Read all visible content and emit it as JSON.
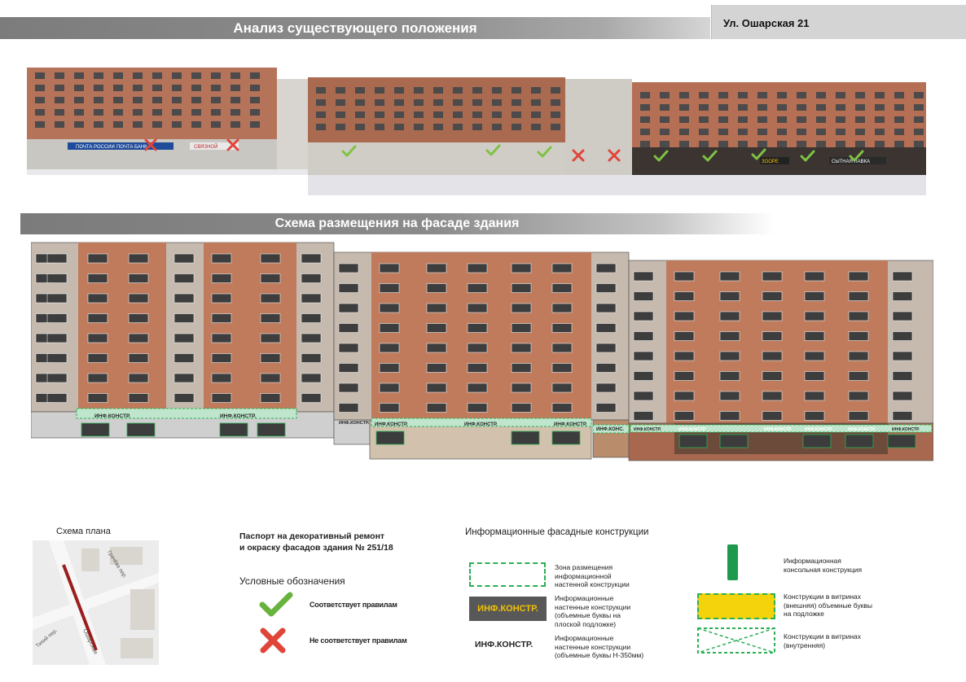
{
  "header": {
    "title": "Анализ существующего положения",
    "address": "Ул. Ошарская 21"
  },
  "photo": {
    "sign_labels": [
      "ПОЧТА РОССИИ",
      "ПОЧТА БАНК",
      "СВЯЗНОЙ",
      "ЗООРЕ",
      "СЫТНАЯ ЛАВКА"
    ],
    "marks": [
      "cross",
      "cross",
      "check",
      "check",
      "check",
      "cross",
      "cross",
      "check",
      "check",
      "check",
      "check",
      "check"
    ]
  },
  "section": {
    "title": "Схема размещения на фасаде здания"
  },
  "elevation": {
    "sign_left": [
      "ИНФ.КОНСТР.",
      "ИНФ.КОНСТР."
    ],
    "sign_middle": [
      "ИНФ.КОНСТР.",
      "ИНФ.КОНСТР.",
      "ИНФ.КОНСТР."
    ],
    "sign_narrow": "ИНФ.КОНС.",
    "sign_right": [
      "ИНФ.КОНСТР.",
      "ИНФ.КОНСТР.",
      "ИНФ.КОНСТР.",
      "ИНФ.КОНСТР.",
      "ИНФ.КОНСТР.",
      "ИНФ.КОНСТР."
    ],
    "side_left": "ИНФ.КОНСТР."
  },
  "plan": {
    "title": "Схема плана",
    "street_labels": [
      "Ошарская",
      "Грачёва пер.",
      "Тихий пер."
    ]
  },
  "passport": {
    "line1": "Паспорт на декоративный ремонт",
    "line2": "и окраску фасадов здания № 251/18"
  },
  "legend": {
    "title": "Условные обозначения",
    "ok": "Соответствует правилам",
    "bad": "Не соответствует правилам"
  },
  "info": {
    "title": "Информационные фасадные конструкции",
    "zone_l1": "Зона размещения",
    "zone_l2": "информационной",
    "zone_l3": "настенной конструкции",
    "flat_sample": "ИНФ.КОНСТР.",
    "flat_l1": "Информационные",
    "flat_l2": "настенные конструкции",
    "flat_l3": "(объемные буквы на",
    "flat_l4": "плоской подложке)",
    "vol_sample": "ИНФ.КОНСТР.",
    "vol_l1": "Информационные",
    "vol_l2": "настенные конструкции",
    "vol_l3": "(объемные буквы Н-350мм)",
    "console_l1": "Информационная",
    "console_l2": "консольная конструкция",
    "vout_l1": "Конструкции в витринах",
    "vout_l2": "(внешняя) объемные буквы",
    "vout_l3": "на подложке",
    "vin_l1": "Конструкции в витринах",
    "vin_l2": "(внутренняя)"
  },
  "colors": {
    "brick": "#c07a5a",
    "green": "#2bb056",
    "cross": "#e0453a",
    "yellow": "#f4d30c"
  }
}
